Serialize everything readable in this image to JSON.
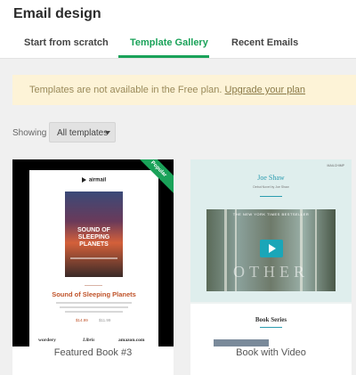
{
  "header": {
    "title": "Email design",
    "tabs": [
      {
        "label": "Start from scratch",
        "active": false
      },
      {
        "label": "Template Gallery",
        "active": true
      },
      {
        "label": "Recent Emails",
        "active": false
      }
    ]
  },
  "banner": {
    "text": "Templates are not available in the Free plan. ",
    "link": "Upgrade your plan"
  },
  "filter": {
    "showing_label": "Showing",
    "selected": "All templates"
  },
  "templates": [
    {
      "label": "Featured Book #3",
      "badge": "Popular",
      "preview": {
        "brand": "airmail",
        "cover_title": "SOUND OF SLEEPING PLANETS",
        "heading": "Sound of Sleeping Planets",
        "price_old": "$14.99",
        "price_new": "$11.99",
        "logos": [
          "wordery",
          "Libris",
          "amazon.com"
        ]
      }
    },
    {
      "label": "Book with Video",
      "preview": {
        "corner": "MAILCHIMP",
        "author": "Joe Shaw",
        "author_sub": "Debut Novel by Joe Shaw",
        "video_top": "THE NEW YORK TIMES BESTSELLER",
        "video_word": "OTHER",
        "section": "Book Series"
      }
    }
  ],
  "colors": {
    "accent": "#1aa259",
    "banner_bg": "#fdf3d7",
    "teal": "#2b9cb0"
  }
}
